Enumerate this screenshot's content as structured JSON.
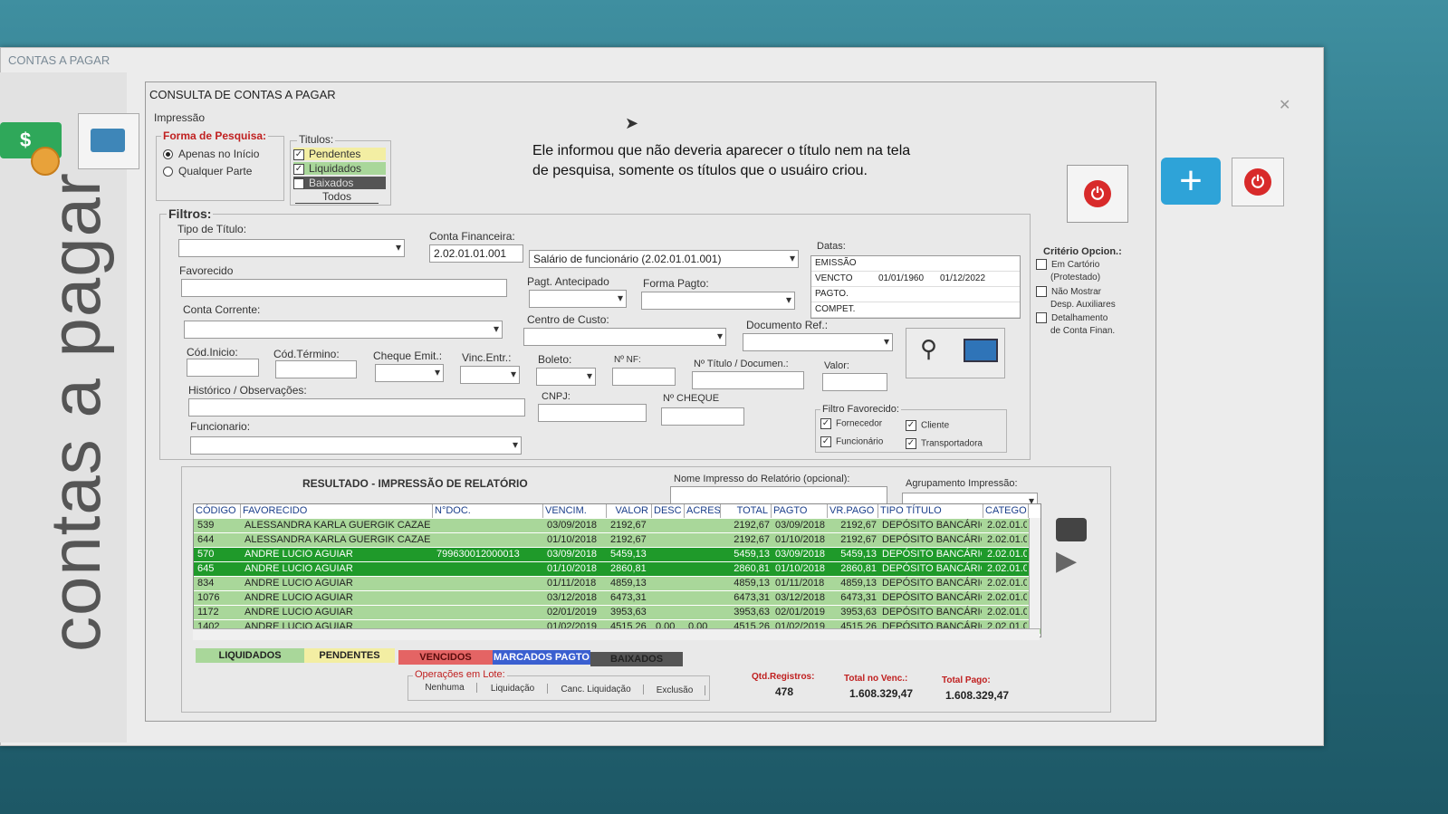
{
  "outer": {
    "title": "CONTAS A PAGAR",
    "side_text": "contas a pagar",
    "money_symbol": "$",
    "plus_symbol": "+",
    "power_symbol": "⏻"
  },
  "dialog": {
    "title": "CONSULTA DE CONTAS A PAGAR",
    "impressao": "Impressão"
  },
  "note": {
    "line1": "Ele informou que não deveria aparecer o título nem na tela",
    "line2": "de pesquisa, somente os títulos que o usuáiro criou."
  },
  "forma": {
    "label": "Forma de Pesquisa:",
    "opt1": "Apenas no Início",
    "opt2": "Qualquer Parte"
  },
  "titulos": {
    "label": "Titulos:",
    "pendentes": "Pendentes",
    "liquidados": "Liquidados",
    "baixados": "Baixados",
    "todos": "Todos"
  },
  "filtros": {
    "label": "Filtros:",
    "tipo_titulo": "Tipo de Título:",
    "conta_financeira": "Conta Financeira:",
    "conta_code": "2.02.01.01.001",
    "conta_desc": "Salário de funcionário (2.02.01.01.001)",
    "favorecido": "Favorecido",
    "pagt_antecipado": "Pagt. Antecipado",
    "forma_pagto": "Forma Pagto:",
    "conta_corrente": "Conta Corrente:",
    "centro_custo": "Centro de Custo:",
    "documento_ref": "Documento Ref.:",
    "cod_inicio": "Cód.Inicio:",
    "cod_termino": "Cód.Término:",
    "cheque_emit": "Cheque Emit.:",
    "vinc_entr": "Vinc.Entr.:",
    "boleto": "Boleto:",
    "nf": "Nº NF:",
    "n_titulo": "Nº Título / Documen.:",
    "valor": "Valor:",
    "historico": "Histórico / Observações:",
    "cnpj": "CNPJ:",
    "n_cheque": "Nº CHEQUE",
    "funcionario": "Funcionario:"
  },
  "datas": {
    "label": "Datas:",
    "rows": [
      {
        "name": "EMISSÃO",
        "from": "",
        "to": ""
      },
      {
        "name": "VENCTO",
        "from": "01/01/1960",
        "to": "01/12/2022"
      },
      {
        "name": "PAGTO.",
        "from": "",
        "to": ""
      },
      {
        "name": "COMPET.",
        "from": "",
        "to": ""
      }
    ]
  },
  "criterio": {
    "label": "Critério Opcion.:",
    "opt1a": "Em Cartório",
    "opt1b": "(Protestado)",
    "opt2a": "Não Mostrar",
    "opt2b": "Desp. Auxiliares",
    "opt3a": "Detalhamento",
    "opt3b": "de Conta Finan."
  },
  "filtro_fav": {
    "label": "Filtro Favorecido:",
    "fornecedor": "Fornecedor",
    "cliente": "Cliente",
    "funcionario": "Funcionário",
    "transportadora": "Transportadora"
  },
  "result": {
    "title": "RESULTADO - IMPRESSÃO DE RELATÓRIO",
    "nome_impresso": "Nome Impresso do Relatório (opcional):",
    "agrupamento": "Agrupamento Impressão:",
    "headers": [
      "CÓDIGO",
      "FAVORECIDO",
      "N°DOC.",
      "VENCIM.",
      "VALOR",
      "DESC",
      "ACRES",
      "TOTAL",
      "PAGTO",
      "VR.PAGO",
      "TIPO TÍTULO",
      "CATEGO"
    ],
    "rows": [
      {
        "codigo": "539",
        "favorecido": "ALESSANDRA KARLA GUERGIK CAZAE",
        "ndoc": "",
        "vencim": "03/09/2018",
        "valor": "2192,67",
        "desc": "",
        "acres": "",
        "total": "2192,67",
        "pagto": "03/09/2018",
        "vrpago": "2192,67",
        "tipo": "DEPÓSITO BANCÁRIO",
        "categ": "2.02.01.0",
        "state": "liq"
      },
      {
        "codigo": "644",
        "favorecido": "ALESSANDRA KARLA GUERGIK CAZAE",
        "ndoc": "",
        "vencim": "01/10/2018",
        "valor": "2192,67",
        "desc": "",
        "acres": "",
        "total": "2192,67",
        "pagto": "01/10/2018",
        "vrpago": "2192,67",
        "tipo": "DEPÓSITO BANCÁRIO",
        "categ": "2.02.01.0",
        "state": "liq"
      },
      {
        "codigo": "570",
        "favorecido": "ANDRE LUCIO AGUIAR",
        "ndoc": "799630012000013",
        "vencim": "03/09/2018",
        "valor": "5459,13",
        "desc": "",
        "acres": "",
        "total": "5459,13",
        "pagto": "03/09/2018",
        "vrpago": "5459,13",
        "tipo": "DEPÓSITO BANCÁRIO",
        "categ": "2.02.01.0",
        "state": "sel"
      },
      {
        "codigo": "645",
        "favorecido": "ANDRE LUCIO AGUIAR",
        "ndoc": "",
        "vencim": "01/10/2018",
        "valor": "2860,81",
        "desc": "",
        "acres": "",
        "total": "2860,81",
        "pagto": "01/10/2018",
        "vrpago": "2860,81",
        "tipo": "DEPÓSITO BANCÁRIO",
        "categ": "2.02.01.0",
        "state": "sel"
      },
      {
        "codigo": "834",
        "favorecido": "ANDRE LUCIO AGUIAR",
        "ndoc": "",
        "vencim": "01/11/2018",
        "valor": "4859,13",
        "desc": "",
        "acres": "",
        "total": "4859,13",
        "pagto": "01/11/2018",
        "vrpago": "4859,13",
        "tipo": "DEPÓSITO BANCÁRIO",
        "categ": "2.02.01.0",
        "state": "liq"
      },
      {
        "codigo": "1076",
        "favorecido": "ANDRE LUCIO AGUIAR",
        "ndoc": "",
        "vencim": "03/12/2018",
        "valor": "6473,31",
        "desc": "",
        "acres": "",
        "total": "6473,31",
        "pagto": "03/12/2018",
        "vrpago": "6473,31",
        "tipo": "DEPÓSITO BANCÁRIO",
        "categ": "2.02.01.0",
        "state": "liq"
      },
      {
        "codigo": "1172",
        "favorecido": "ANDRE LUCIO AGUIAR",
        "ndoc": "",
        "vencim": "02/01/2019",
        "valor": "3953,63",
        "desc": "",
        "acres": "",
        "total": "3953,63",
        "pagto": "02/01/2019",
        "vrpago": "3953,63",
        "tipo": "DEPÓSITO BANCÁRIO",
        "categ": "2.02.01.0",
        "state": "liq"
      },
      {
        "codigo": "1402",
        "favorecido": "ANDRE LUCIO AGUIAR",
        "ndoc": "",
        "vencim": "01/02/2019",
        "valor": "4515,26",
        "desc": "0,00",
        "acres": "0,00",
        "total": "4515,26",
        "pagto": "01/02/2019",
        "vrpago": "4515,26",
        "tipo": "DEPÓSITO BANCÁRIO",
        "categ": "2.02.01.0",
        "state": "liq"
      }
    ]
  },
  "legend": {
    "liquidados": "LIQUIDADOS",
    "pendentes": "PENDENTES",
    "vencidos": "VENCIDOS",
    "marcados": "MARCADOS PAGTO",
    "baixados": "BAIXADOS"
  },
  "lote": {
    "label": "Operações em Lote:",
    "nenhuma": "Nenhuma",
    "liquidacao": "Liquidação",
    "canc": "Canc. Liquidação",
    "exclusao": "Exclusão"
  },
  "stats": {
    "qtd_label": "Qtd.Registros:",
    "qtd": "478",
    "venc_label": "Total no Venc.:",
    "venc": "1.608.329,47",
    "pago_label": "Total Pago:",
    "pago": "1.608.329,47"
  },
  "colors": {
    "liquidado": "#a9d79a",
    "selecionado": "#1f9a2a",
    "pendente": "#f3eea3",
    "vencido": "#e46464",
    "marcado": "#3a5fd0",
    "baixado": "#555555"
  }
}
